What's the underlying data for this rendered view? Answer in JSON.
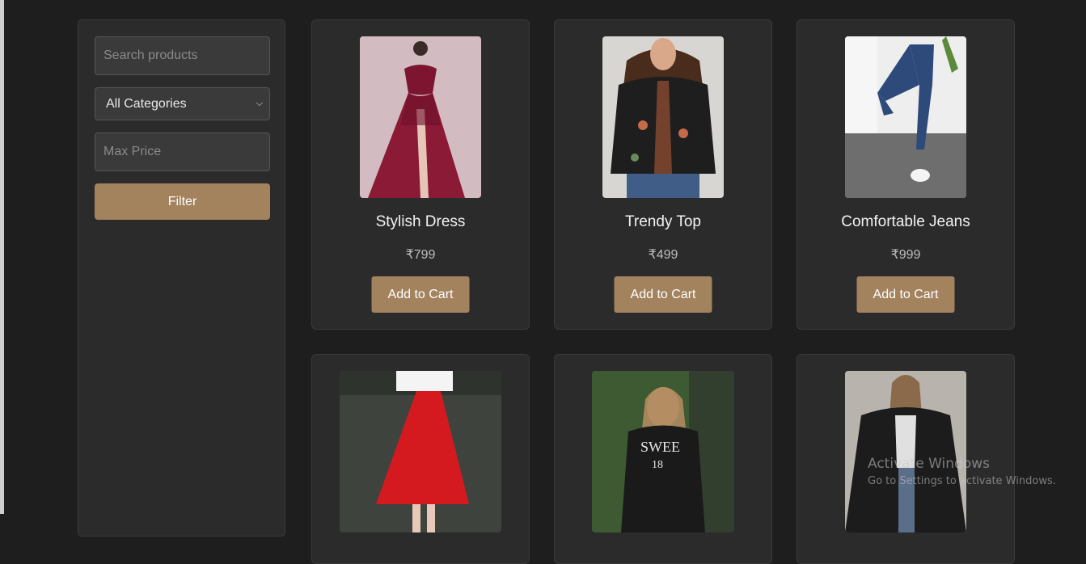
{
  "filters": {
    "search_placeholder": "Search products",
    "category_selected": "All Categories",
    "max_price_placeholder": "Max Price",
    "filter_label": "Filter"
  },
  "products": [
    {
      "name": "Stylish Dress",
      "price": "₹799",
      "button": "Add to Cart",
      "image": "red-gown-photo"
    },
    {
      "name": "Trendy Top",
      "price": "₹499",
      "button": "Add to Cart",
      "image": "embroidered-black-top-photo"
    },
    {
      "name": "Comfortable Jeans",
      "price": "₹999",
      "button": "Add to Cart",
      "image": "blue-jeans-photo"
    },
    {
      "image": "red-skirt-photo"
    },
    {
      "image": "black-tshirt-photo"
    },
    {
      "image": "leather-jacket-photo"
    }
  ],
  "watermark": {
    "title": "Activate Windows",
    "subtitle": "Go to Settings to activate Windows."
  },
  "colors": {
    "background": "#1e1e1e",
    "panel": "#2b2b2b",
    "accent": "#a3825e"
  }
}
